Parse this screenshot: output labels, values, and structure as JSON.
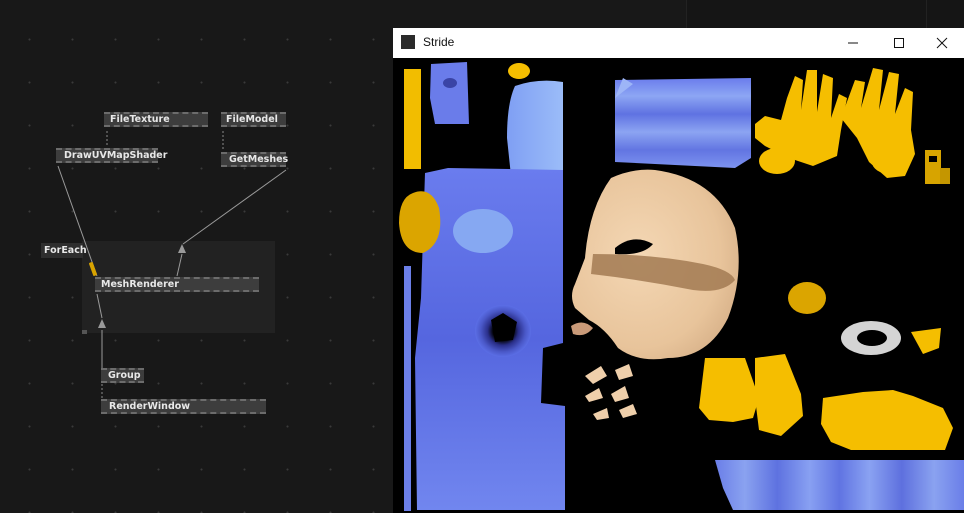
{
  "patch": {
    "nodes": {
      "file_texture": "FileTexture",
      "file_model": "FileModel",
      "draw_uv_map_shader": "DrawUVMapShader",
      "get_meshes": "GetMeshes",
      "for_each": "ForEach",
      "mesh_renderer": "MeshRenderer",
      "group": "Group",
      "render_window": "RenderWindow"
    }
  },
  "window": {
    "title": "Stride",
    "icons": {
      "app": "app-icon",
      "minimize": "minimize-icon",
      "maximize": "maximize-icon",
      "close": "close-icon"
    }
  },
  "colors": {
    "patch_background": "#181818",
    "node": "#3d3d3d",
    "uv_blue": "#5b6ee6",
    "uv_light_blue": "#7aa4f2",
    "uv_yellow": "#f5be00",
    "uv_skin": "#efcfab",
    "uv_grey": "#cfcfcf"
  }
}
